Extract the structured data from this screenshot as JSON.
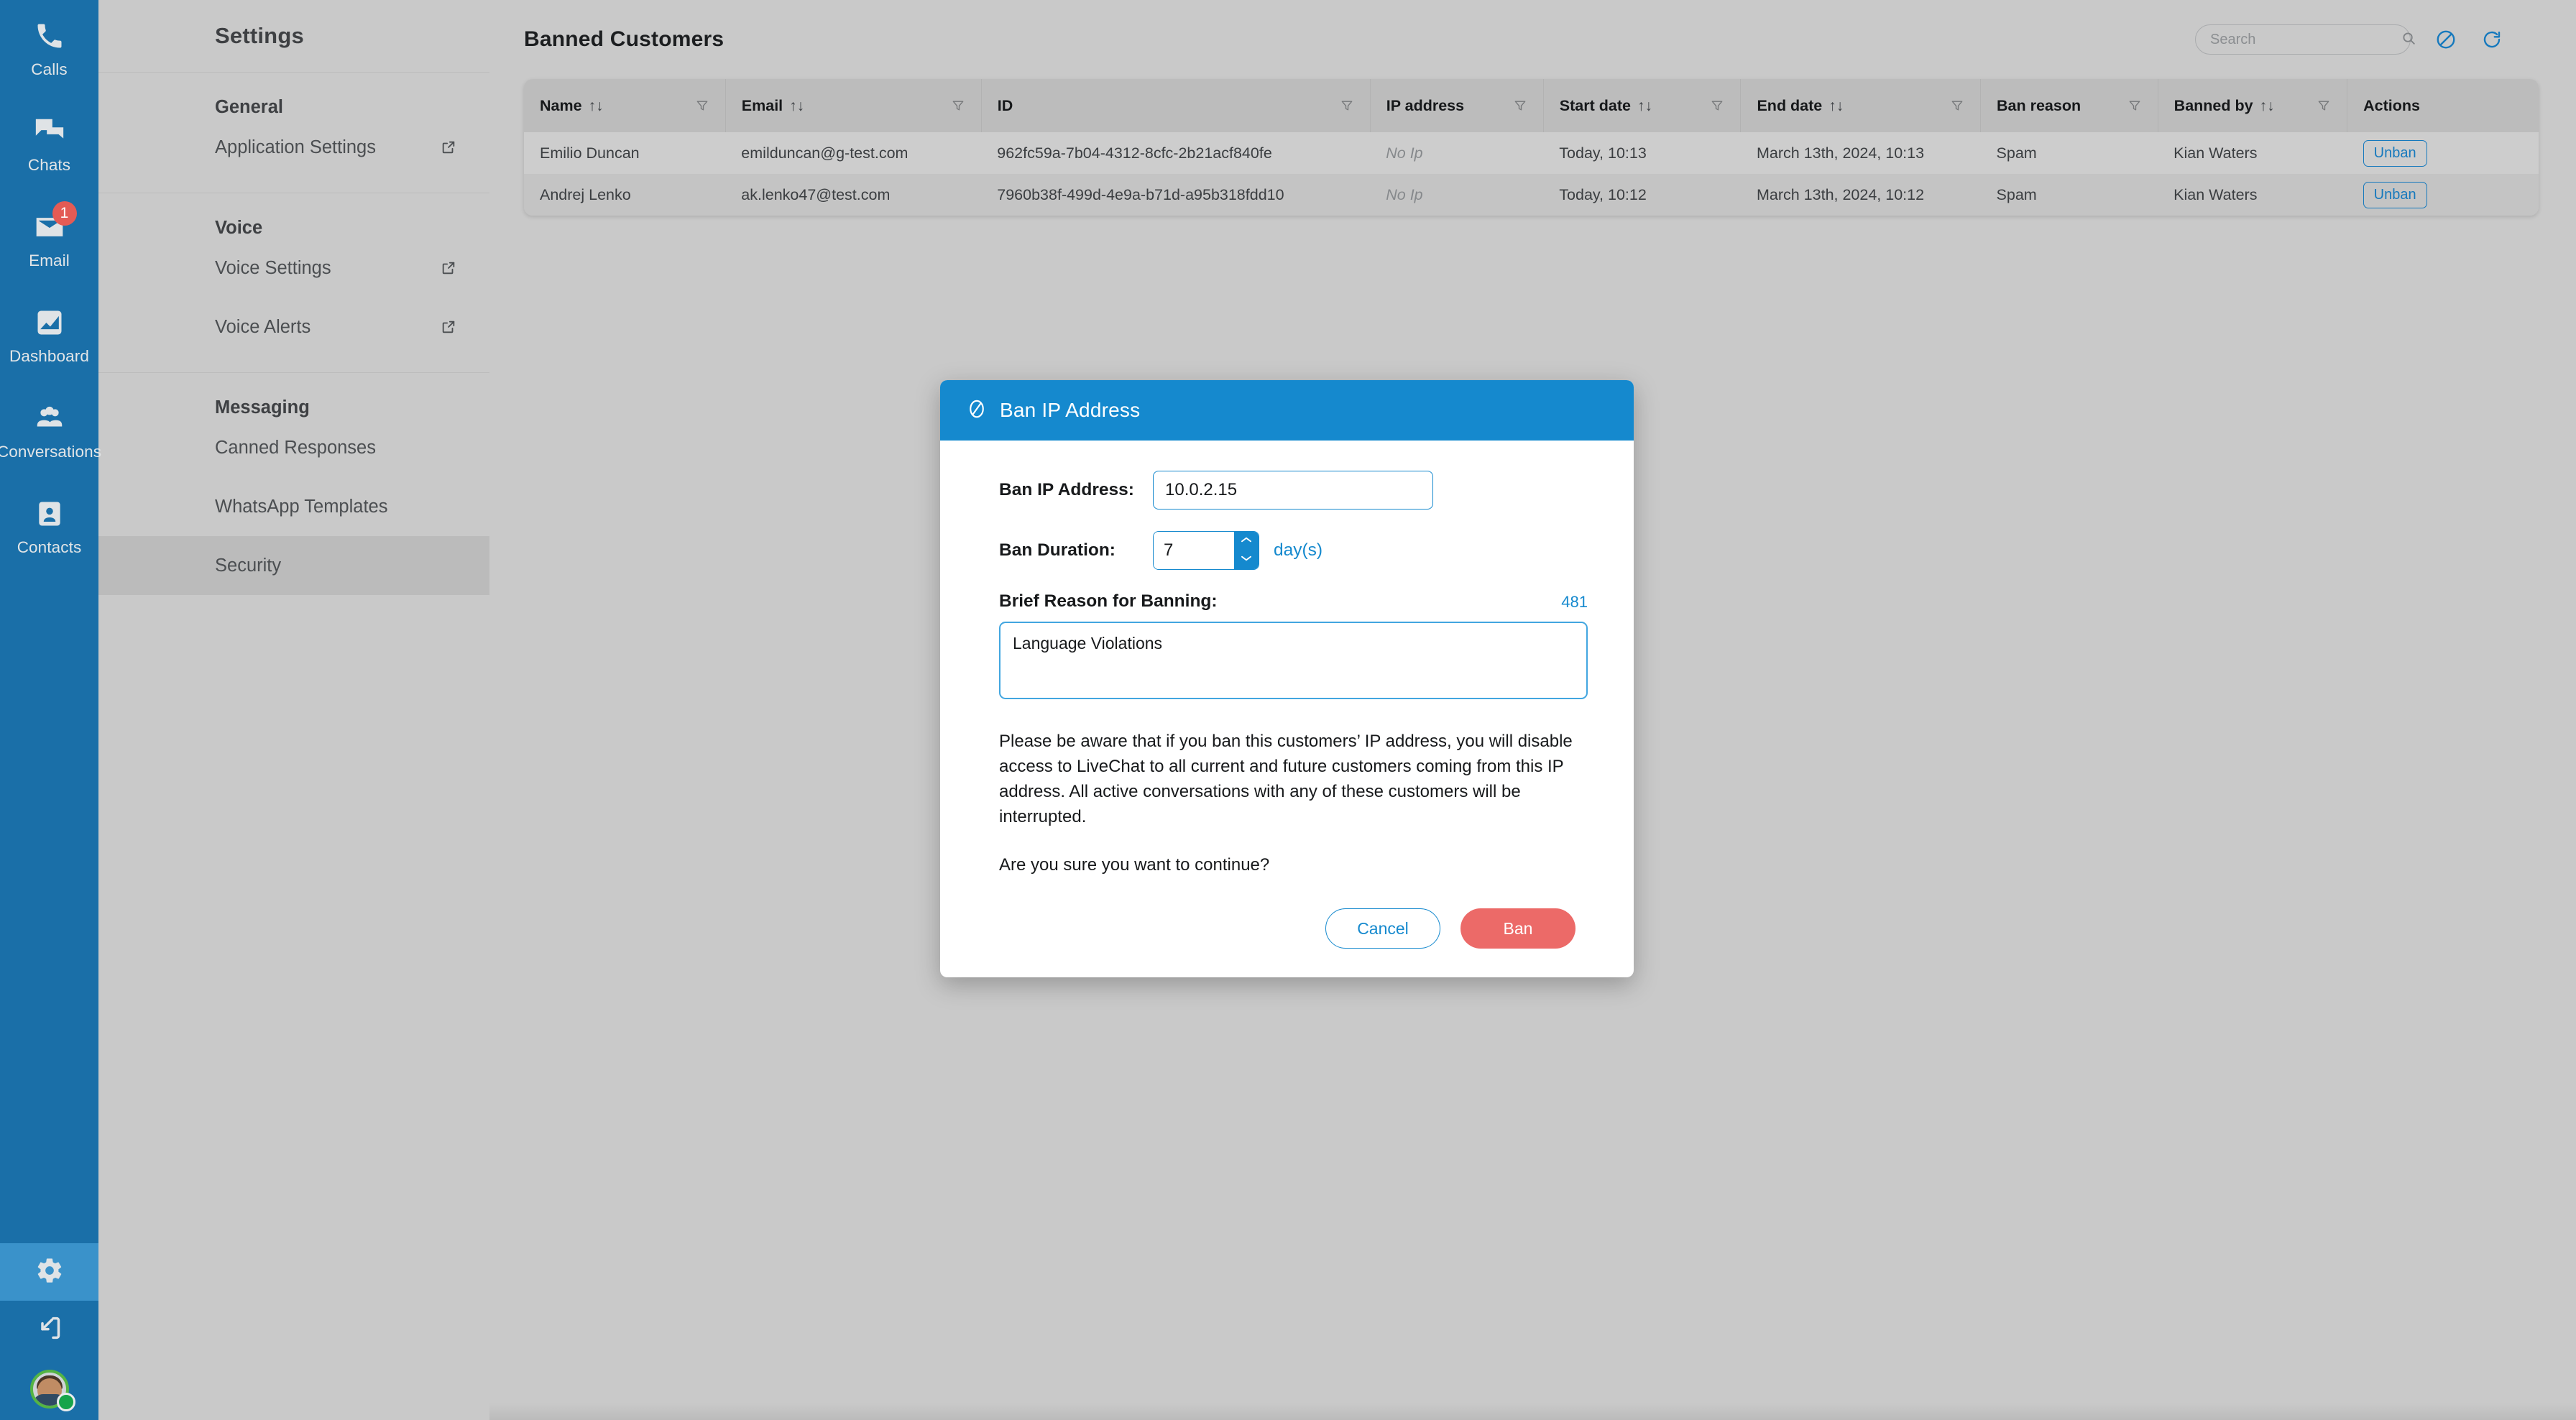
{
  "rail": {
    "items": [
      {
        "label": "Calls",
        "icon": "phone-icon",
        "badge": null
      },
      {
        "label": "Chats",
        "icon": "chat-bubbles-icon",
        "badge": null
      },
      {
        "label": "Email",
        "icon": "envelope-icon",
        "badge": "1"
      },
      {
        "label": "Dashboard",
        "icon": "dashboard-chart-icon",
        "badge": null
      },
      {
        "label": "Conversations",
        "icon": "people-group-icon",
        "badge": null
      },
      {
        "label": "Contacts",
        "icon": "contact-card-icon",
        "badge": null
      }
    ],
    "bottom": [
      {
        "name": "settings-gear",
        "icon": "gear-icon",
        "active": true
      },
      {
        "name": "logout",
        "icon": "logout-arrow-icon",
        "active": false
      }
    ],
    "avatar_status_color": "#17a44a"
  },
  "settings": {
    "title": "Settings",
    "groups": [
      {
        "heading": "General",
        "items": [
          {
            "label": "Application Settings",
            "external": true,
            "active": false
          }
        ]
      },
      {
        "heading": "Voice",
        "items": [
          {
            "label": "Voice Settings",
            "external": true,
            "active": false
          },
          {
            "label": "Voice Alerts",
            "external": true,
            "active": false
          }
        ]
      },
      {
        "heading": "Messaging",
        "items": [
          {
            "label": "Canned Responses",
            "external": false,
            "active": false
          },
          {
            "label": "WhatsApp Templates",
            "external": false,
            "active": false
          },
          {
            "label": "Security",
            "external": false,
            "active": true
          }
        ]
      }
    ]
  },
  "header": {
    "title": "Banned Customers",
    "search": {
      "value": "",
      "placeholder": "Search"
    },
    "actions": [
      {
        "name": "ban-icon",
        "title": "Ban"
      },
      {
        "name": "refresh-icon",
        "title": "Refresh"
      }
    ]
  },
  "table": {
    "columns": [
      {
        "label": "Name",
        "sortable": true,
        "filterable": true,
        "width": "10.0%"
      },
      {
        "label": "Email",
        "sortable": true,
        "filterable": true,
        "width": "12.7%"
      },
      {
        "label": "ID",
        "sortable": false,
        "filterable": true,
        "width": "19.3%"
      },
      {
        "label": "IP address",
        "sortable": false,
        "filterable": true,
        "width": "8.6%"
      },
      {
        "label": "Start date",
        "sortable": true,
        "filterable": true,
        "width": "9.8%"
      },
      {
        "label": "End date",
        "sortable": true,
        "filterable": true,
        "width": "11.9%"
      },
      {
        "label": "Ban reason",
        "sortable": false,
        "filterable": true,
        "width": "8.8%"
      },
      {
        "label": "Banned by",
        "sortable": true,
        "filterable": true,
        "width": "9.4%"
      },
      {
        "label": "Actions",
        "sortable": false,
        "filterable": false,
        "width": "9.5%"
      }
    ],
    "action_label": "Unban",
    "rows": [
      {
        "name": "Emilio Duncan",
        "email": "emilduncan@g-test.com",
        "id": "962fc59a-7b04-4312-8cfc-2b21acf840fe",
        "ip": "No Ip",
        "start_date": "Today, 10:13",
        "end_date": "March 13th, 2024, 10:13",
        "ban_reason": "Spam",
        "banned_by": "Kian Waters"
      },
      {
        "name": "Andrej Lenko",
        "email": "ak.lenko47@test.com",
        "id": "7960b38f-499d-4e9a-b71d-a95b318fdd10",
        "ip": "No Ip",
        "start_date": "Today, 10:12",
        "end_date": "March 13th, 2024, 10:12",
        "ban_reason": "Spam",
        "banned_by": "Kian Waters"
      }
    ]
  },
  "modal": {
    "title": "Ban IP Address",
    "title_icon": "ban-circle-icon",
    "ip_label": "Ban IP Address:",
    "ip_value": "10.0.2.15",
    "duration_label": "Ban Duration:",
    "duration_value": "7",
    "duration_unit": "day(s)",
    "reason_label": "Brief Reason for Banning:",
    "reason_counter": "481",
    "reason_value": "Language Violations",
    "warning": "Please be aware that if you ban this customers’ IP address, you will disable access to LiveChat to all current and future customers coming from this IP address. All active conversations with any of these customers will be interrupted.",
    "confirm": "Are you sure you want to continue?",
    "cancel_label": "Cancel",
    "ban_label": "Ban"
  },
  "colors": {
    "rail_blue": "#1a6fa8",
    "rail_active": "#3a92ca",
    "modal_blue": "#1589ce",
    "ban_red": "#ec6a68",
    "link_blue": "#1679bd",
    "badge_red": "#e35b55",
    "page_bg": "#c9c9c9"
  }
}
